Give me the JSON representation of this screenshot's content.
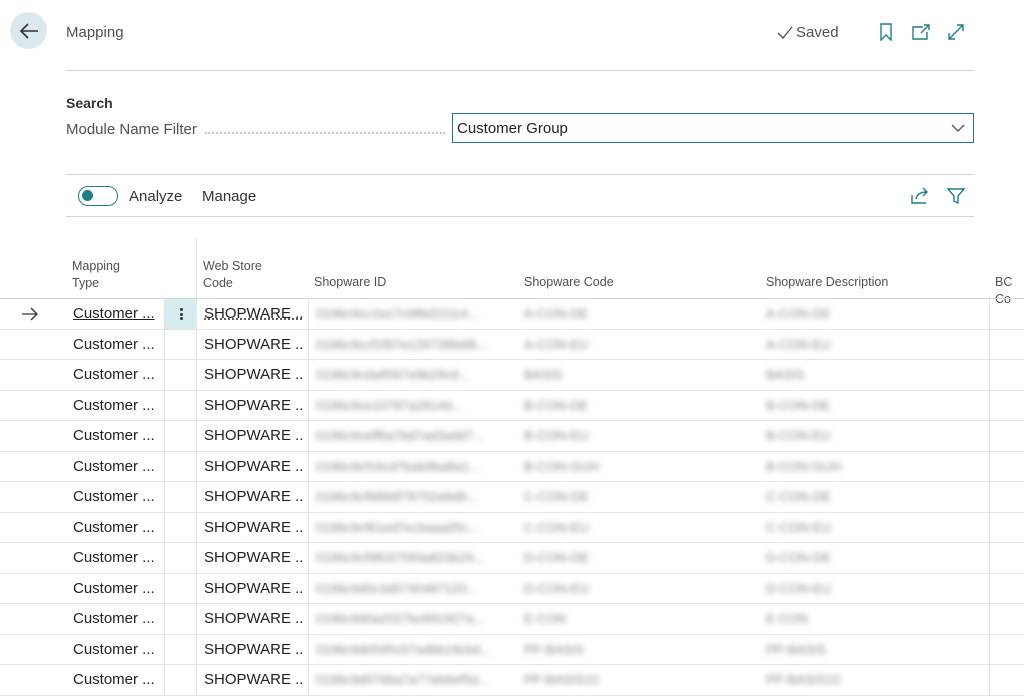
{
  "header": {
    "title": "Mapping",
    "saved_label": "Saved",
    "icons": [
      "back-arrow-icon",
      "check-icon",
      "bookmark-icon",
      "open-new-window-icon",
      "expand-icon"
    ]
  },
  "search": {
    "section_title": "Search",
    "filter_label": "Module Name Filter",
    "filter_value": "Customer Group"
  },
  "toolbar": {
    "analyze_label": "Analyze",
    "manage_label": "Manage",
    "analyze_on": false,
    "icons": [
      "share-icon",
      "filter-icon"
    ]
  },
  "table": {
    "columns": {
      "mapping_type_1": "Mapping",
      "mapping_type_2": "Type",
      "web_store_1": "Web Store",
      "web_store_2": "Code",
      "shopware_id": "Shopware ID",
      "shopware_code": "Shopware Code",
      "shopware_description": "Shopware Description",
      "bc_code": "BC Co"
    },
    "rows": [
      {
        "mapping_type": "Customer ...",
        "web_store_code": "SHOPWARE ...",
        "shopware_id": "0196c9cc2a17c0f8d22114...",
        "shopware_code": "A-CON-DE",
        "shopware_description": "A-CON-DE"
      },
      {
        "mapping_type": "Customer ...",
        "web_store_code": "SHOPWARE ...",
        "shopware_id": "0196c9ccf1f97e129739fa98...",
        "shopware_code": "A-CON-EU",
        "shopware_description": "A-CON-EU"
      },
      {
        "mapping_type": "Customer ...",
        "web_store_code": "SHOPWARE ...",
        "shopware_id": "0196c9cda8567e9b29cd...",
        "shopware_code": "BASIS",
        "shopware_description": "BASIS"
      },
      {
        "mapping_type": "Customer ...",
        "web_store_code": "SHOPWARE ...",
        "shopware_id": "0196c9ce10787a2814d...",
        "shopware_code": "B-CON-DE",
        "shopware_description": "B-CON-DE"
      },
      {
        "mapping_type": "Customer ...",
        "web_store_code": "SHOPWARE ...",
        "shopware_id": "0196c9ceff6a7bd7ad3add7...",
        "shopware_code": "B-CON-EU",
        "shopware_description": "B-CON-EU"
      },
      {
        "mapping_type": "Customer ...",
        "web_store_code": "SHOPWARE ...",
        "shopware_id": "0196c9cf16cd7bab9ba8a1...",
        "shopware_code": "B-CON-GUH",
        "shopware_description": "B-CON-GUH"
      },
      {
        "mapping_type": "Customer ...",
        "web_store_code": "SHOPWARE ...",
        "shopware_id": "0196c9cf6866f78702a9d9...",
        "shopware_code": "C-CON-DE",
        "shopware_description": "C-CON-DE"
      },
      {
        "mapping_type": "Customer ...",
        "web_store_code": "SHOPWARE ...",
        "shopware_id": "0196c9cf61ed7ecbaaa05c...",
        "shopware_code": "C-CON-EU",
        "shopware_description": "C-CON-EU"
      },
      {
        "mapping_type": "Customer ...",
        "web_store_code": "SHOPWARE ...",
        "shopware_id": "0196c9cf9f037593a823b24...",
        "shopware_code": "D-CON-DE",
        "shopware_description": "D-CON-DE"
      },
      {
        "mapping_type": "Customer ...",
        "web_store_code": "SHOPWARE ...",
        "shopware_id": "0196c9d0c3d5740487120...",
        "shopware_code": "D-CON-EU",
        "shopware_description": "D-CON-EU"
      },
      {
        "mapping_type": "Customer ...",
        "web_store_code": "SHOPWARE ...",
        "shopware_id": "0196c9d0a2027bc891927a...",
        "shopware_code": "E-CON",
        "shopware_description": "E-CON"
      },
      {
        "mapping_type": "Customer ...",
        "web_store_code": "SHOPWARE ...",
        "shopware_id": "0196c9d0595c07ad6b19cbd...",
        "shopware_code": "PP-BASIS",
        "shopware_description": "PP-BASIS"
      },
      {
        "mapping_type": "Customer ...",
        "web_store_code": "SHOPWARE ...",
        "shopware_id": "0196c9d076ba7a77eb9ef5d...",
        "shopware_code": "PP-BASIS10",
        "shopware_description": "PP-BASIS10"
      }
    ]
  },
  "colors": {
    "accent": "#1f7f86",
    "back_button_bg": "#dbe9ee",
    "selected_cell_bg": "#d6ecee"
  }
}
